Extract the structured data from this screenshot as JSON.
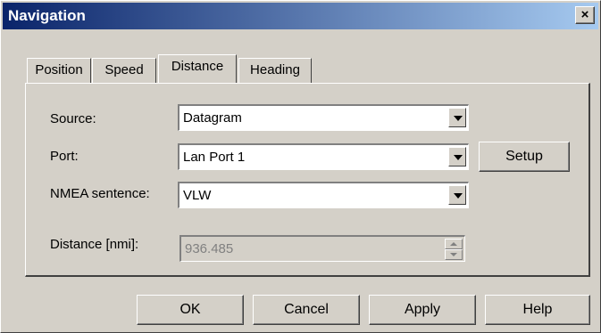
{
  "window": {
    "title": "Navigation",
    "close_symbol": "×"
  },
  "tabs": [
    {
      "label": "Position"
    },
    {
      "label": "Speed"
    },
    {
      "label": "Distance",
      "active": true
    },
    {
      "label": "Heading"
    }
  ],
  "form": {
    "source_label": "Source:",
    "source_value": "Datagram",
    "port_label": "Port:",
    "port_value": "Lan Port 1",
    "nmea_label": "NMEA sentence:",
    "nmea_value": "VLW",
    "distance_label": "Distance [nmi]:",
    "distance_value": "936.485",
    "setup_label": "Setup"
  },
  "buttons": {
    "ok": "OK",
    "cancel": "Cancel",
    "apply": "Apply",
    "help": "Help"
  },
  "colors": {
    "titlebar_start": "#0a246a",
    "titlebar_end": "#a6caf0",
    "face": "#d4d0c8"
  }
}
